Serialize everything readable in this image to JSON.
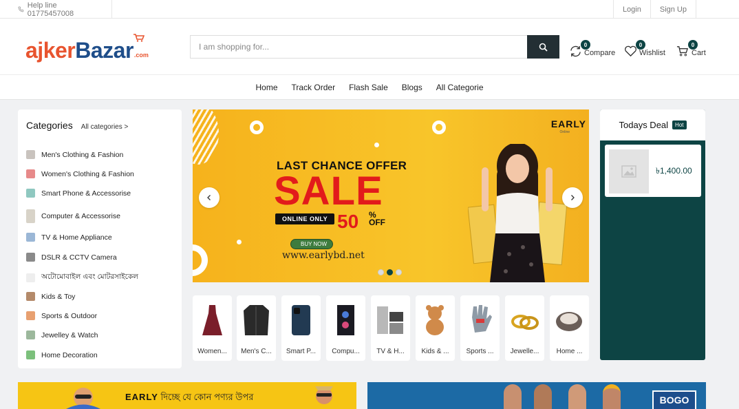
{
  "topbar": {
    "helpline": "Help line 01775457008",
    "login": "Login",
    "signup": "Sign Up"
  },
  "header": {
    "logo_part1": "ajker",
    "logo_part2": "Bazar",
    "logo_suffix": ".com",
    "search_placeholder": "I am shopping for...",
    "compare": {
      "label": "Compare",
      "count": "0"
    },
    "wishlist": {
      "label": "Wishlist",
      "count": "0"
    },
    "cart": {
      "label": "Cart",
      "count": "0"
    }
  },
  "nav": {
    "items": [
      "Home",
      "Track Order",
      "Flash Sale",
      "Blogs",
      "All Categorie"
    ]
  },
  "categories": {
    "title": "Categories",
    "all_link": "All categories >",
    "items": [
      "Men's Clothing & Fashion",
      "Women's Clothing & Fashion",
      "Smart Phone & Accessorise",
      "Computer & Accessorise",
      "TV & Home Appliance",
      "DSLR & CCTV Camera",
      "অটোমোবাইল এবং মোটরসাইকেল",
      "Kids & Toy",
      "Sports & Outdoor",
      "Jewelley & Watch",
      "Home Decoration"
    ]
  },
  "slider": {
    "line1": "LAST CHANCE OFFER",
    "line2": "SALE",
    "badge": "ONLINE ONLY",
    "discount": "50",
    "pct": "%",
    "off": "OFF",
    "buy": "BUY NOW",
    "website": "www.earlybd.net",
    "brand": "EARLY",
    "brand_sub": "Online",
    "active_slide": 2,
    "slide_count": 3
  },
  "tiles": [
    "Women...",
    "Men's C...",
    "Smart P...",
    "Compu...",
    "TV & H...",
    "Kids & ...",
    "Sports ...",
    "Jewelle...",
    "Home ..."
  ],
  "deal": {
    "title": "Todays Deal",
    "hot": "Hot",
    "price": "৳1,400.00"
  },
  "banners": {
    "left_text_brand": "EARLY",
    "left_text": " দিচ্ছে যে কোন পণ্যর উপর",
    "right_badge": "BOGO"
  },
  "colors": {
    "accent": "#0d4444",
    "logo_orange": "#e8542f",
    "logo_blue": "#1f4e8a",
    "sale_red": "#e21b1b",
    "banner_yellow": "#f6c514"
  }
}
